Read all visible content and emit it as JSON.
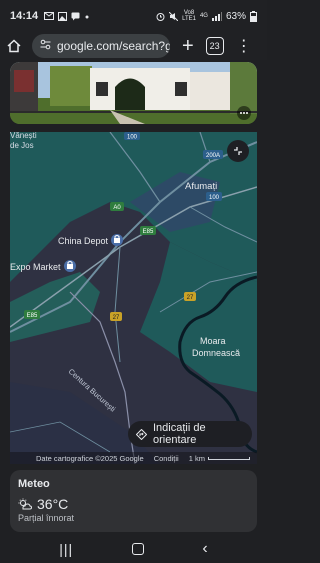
{
  "status_bar": {
    "time": "14:14",
    "left_icons": [
      "mail-icon",
      "image-icon",
      "chat-icon",
      "dot"
    ],
    "network_top": "Vo8",
    "network_mid": "4G",
    "network_bottom": "LTE1",
    "battery_percent": "63%"
  },
  "browser": {
    "url": "google.com/search?gs_",
    "tab_count": "23"
  },
  "map": {
    "places": {
      "vanestii_line1": "Vănești",
      "vanestii_line2": "de Jos",
      "afumati": "Afumați",
      "china_depot": "China Depot",
      "expo_market": "Expo Market",
      "moara_line1": "Moara",
      "moara_line2": "Domnească",
      "centura": "Centura București"
    },
    "road_shields": {
      "r100_top": "100",
      "r200a": "200A",
      "r100_right": "100",
      "a0": "A0",
      "e85_top": "E85",
      "e85_left": "E85",
      "r27_left": "27",
      "r27_right": "27"
    },
    "directions_label": "Indicații de orientare",
    "footer": {
      "credits": "Date cartografice ©2025 Google",
      "terms": "Condiții",
      "scale": "1 km"
    }
  },
  "weather": {
    "title": "Meteo",
    "temperature": "36°C",
    "condition": "Parțial înnorat"
  }
}
